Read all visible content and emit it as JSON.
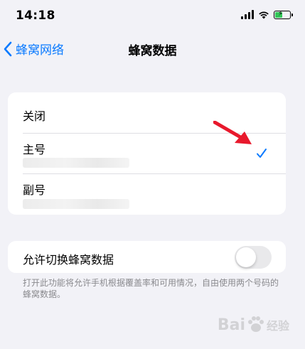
{
  "status_bar": {
    "time": "14:18"
  },
  "nav": {
    "back_label": "蜂窝网络",
    "title": "蜂窝数据"
  },
  "options": [
    {
      "label": "关闭",
      "selected": false
    },
    {
      "label": "主号",
      "selected": true
    },
    {
      "label": "副号",
      "selected": false
    }
  ],
  "switching": {
    "label": "允许切换蜂窝数据",
    "enabled": false,
    "footnote": "打开此功能将允许手机根据覆盖率和可用情况，自由使用两个号码的蜂窝数据。"
  },
  "watermark": {
    "text": "Bai",
    "text2": "经验"
  },
  "colors": {
    "accent": "#0a7aff",
    "arrow": "#e8192c",
    "background": "#f2f2f7",
    "battery": "#34c759"
  },
  "icons": [
    "cellular-signal-icon",
    "wifi-icon",
    "battery-charging-icon",
    "chevron-left-icon",
    "checkmark-icon",
    "red-arrow-icon"
  ]
}
